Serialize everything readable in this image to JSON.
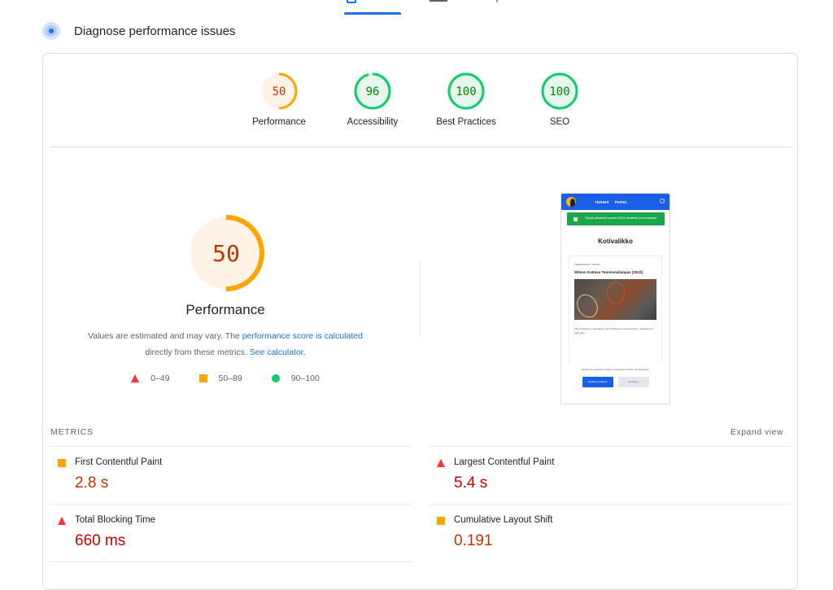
{
  "top_tabs": [
    {
      "label": "Mobile",
      "icon": "phone-icon",
      "active": true
    },
    {
      "label": "Desktop",
      "icon": "desktop-icon",
      "active": false
    }
  ],
  "header": {
    "icon": "diagnose-speedometer-icon",
    "title": "Diagnose performance issues"
  },
  "colors": {
    "fail": "#ff3333",
    "fail_text": "#cc0000",
    "average": "#ffa400",
    "average_text": "#c33300",
    "pass": "#0cce6b",
    "pass_text": "#008800",
    "link": "#1a73e8"
  },
  "categories": [
    {
      "label": "Performance",
      "score": 50,
      "rating": "average"
    },
    {
      "label": "Accessibility",
      "score": 96,
      "rating": "pass"
    },
    {
      "label": "Best Practices",
      "score": 100,
      "rating": "pass"
    },
    {
      "label": "SEO",
      "score": 100,
      "rating": "pass"
    }
  ],
  "performance": {
    "score": 50,
    "title": "Performance",
    "description_prefix": "Values are estimated and may vary. The ",
    "link1": "performance score is calculated",
    "description_mid": " directly from these metrics. ",
    "link2": "See calculator.",
    "legend": [
      {
        "symbol": "triangle",
        "range": "0–49"
      },
      {
        "symbol": "square",
        "range": "50–89"
      },
      {
        "symbol": "circle",
        "range": "90–100"
      }
    ]
  },
  "screenshot": {
    "nav_links": [
      "TENNIS",
      "PADEL"
    ],
    "banner": "Tässä päivitetyt vuoden 2024 kesäleirit ja turnaukset",
    "heading": "Kotivalikko",
    "post_category": "TENNISMAILAT, TENNIS",
    "post_title": "Wilson Kattava Tennismailaopas [2023]",
    "post_text": "Tämä artikkeli on täydellinen opas Wilsonin tennismailoihin. Oppaassa on käyty läpi",
    "cookie_text": "Käytämme evästeitä parhaan käyttökokemuksen takaamiseksi.",
    "accept_button": "Hyväksy evästeet",
    "decline_button": "Kieltäydy"
  },
  "metrics": {
    "label": "METRICS",
    "expand_label": "Expand view",
    "left": [
      {
        "name": "First Contentful Paint",
        "value": "2.8 s",
        "rating": "average"
      },
      {
        "name": "Total Blocking Time",
        "value": "660 ms",
        "rating": "fail"
      }
    ],
    "right": [
      {
        "name": "Largest Contentful Paint",
        "value": "5.4 s",
        "rating": "fail"
      },
      {
        "name": "Cumulative Layout Shift",
        "value": "0.191",
        "rating": "average"
      }
    ]
  }
}
